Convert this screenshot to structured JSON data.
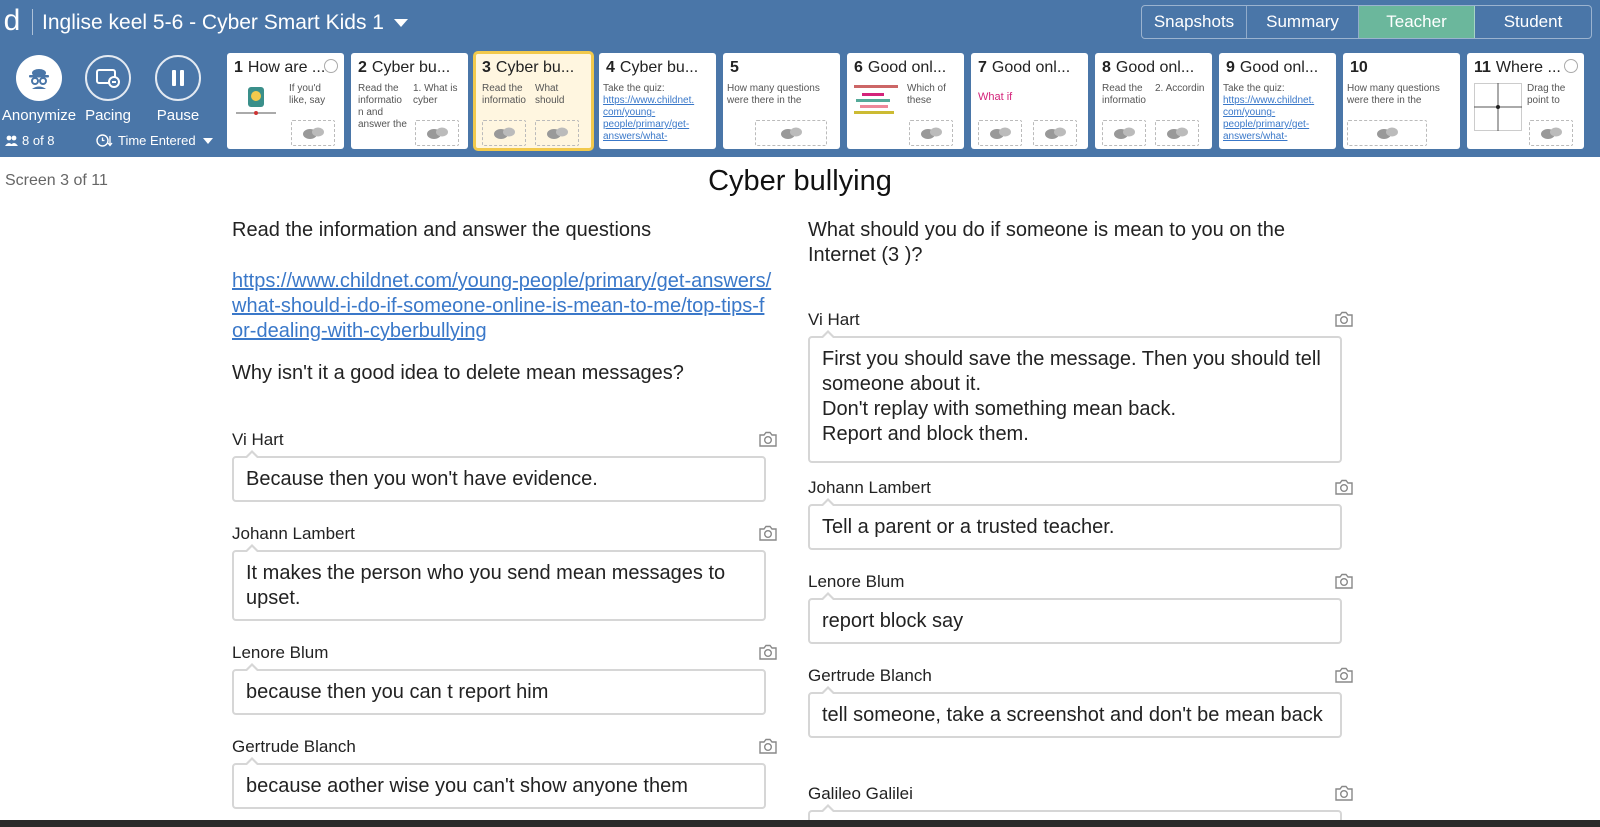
{
  "topbar": {
    "logo": "d",
    "activity_title": "Inglise keel 5-6 - Cyber Smart Kids 1",
    "modes": [
      {
        "label": "Snapshots",
        "active": false
      },
      {
        "label": "Summary",
        "active": false
      },
      {
        "label": "Teacher",
        "active": true
      },
      {
        "label": "Student",
        "active": false
      }
    ]
  },
  "controls": {
    "anonymize_label": "Anonymize",
    "pacing_label": "Pacing",
    "pause_label": "Pause",
    "student_count": "8 of 8",
    "sort_label": "Time Entered"
  },
  "screens": [
    {
      "num": "1",
      "title": "How are ...",
      "snippet": "If you'd like, say"
    },
    {
      "num": "2",
      "title": "Cyber bu...",
      "snippet": "Read the informatio n and answer the",
      "snippet2": "1. What is cyber"
    },
    {
      "num": "3",
      "title": "Cyber bu...",
      "snippet": "Read the informatio",
      "snippet2": "What should"
    },
    {
      "num": "4",
      "title": "Cyber bu...",
      "snippet": "Take the quiz:",
      "link": "https://www.childnet. com/young- people/primary/get- answers/what-"
    },
    {
      "num": "5",
      "title": "",
      "snippet": "How many questions were there in the"
    },
    {
      "num": "6",
      "title": "Good onl...",
      "snippet": "Which of these"
    },
    {
      "num": "7",
      "title": "Good onl...",
      "snippet": "What if"
    },
    {
      "num": "8",
      "title": "Good onl...",
      "snippet": "Read the informatio",
      "snippet2": "2. Accordin"
    },
    {
      "num": "9",
      "title": "Good onl...",
      "snippet": "Take the quiz:",
      "link": "https://www.childnet. com/young- people/primary/get- answers/what-"
    },
    {
      "num": "10",
      "title": "",
      "snippet": "How many questions were there in the"
    },
    {
      "num": "11",
      "title": "Where ...",
      "snippet": "Drag the point to"
    }
  ],
  "main": {
    "screen_count": "Screen 3 of 11",
    "title": "Cyber bullying",
    "left": {
      "intro": "Read the information and answer the questions",
      "link": "https://www.childnet.com/young-people/primary/get-answers/what-should-i-do-if-someone-online-is-mean-to-me/top-tips-for-dealing-with-cyberbullying",
      "question": "Why isn't it a good idea to delete mean messages?",
      "responses": [
        {
          "name": "Vi Hart",
          "text": "Because then you won't have evidence."
        },
        {
          "name": "Johann Lambert",
          "text": "It makes the person who you send mean messages to upset."
        },
        {
          "name": "Lenore Blum",
          "text": "because then you can t report him"
        },
        {
          "name": "Gertrude Blanch",
          "text": "because aother wise you can't show anyone them"
        }
      ]
    },
    "right": {
      "question": "What should you do if someone is mean to you on the Internet (3 )?",
      "responses": [
        {
          "name": "Vi Hart",
          "text": "First you should save the message. Then you should tell someone about it.\nDon't replay with something mean back.\nReport and block them."
        },
        {
          "name": "Johann Lambert",
          "text": "Tell a parent or a trusted teacher."
        },
        {
          "name": "Lenore Blum",
          "text": "report block say"
        },
        {
          "name": "Gertrude Blanch",
          "text": "tell someone, take a screenshot and don't be mean back"
        },
        {
          "name": "Galileo Galilei",
          "text": ""
        }
      ]
    }
  },
  "colors": {
    "header_bg": "#4a76a8",
    "active_mode": "#6bb79c",
    "current_card_border": "#f2c94c",
    "link": "#3a78c9"
  }
}
